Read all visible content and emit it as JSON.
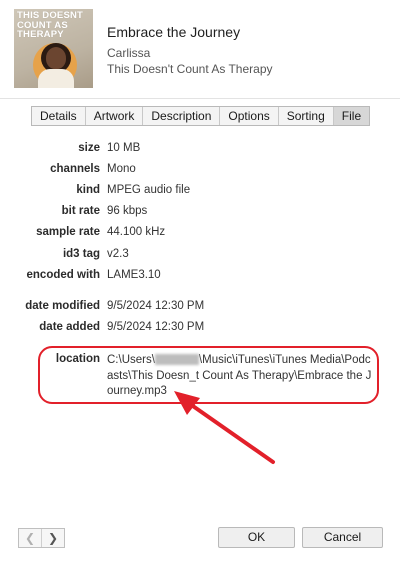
{
  "header": {
    "title": "Embrace the Journey",
    "artist": "Carlissa",
    "album": "This Doesn't Count As Therapy",
    "artwork_text": "THIS DOESNT COUNT AS THERAPY"
  },
  "tabs": [
    {
      "label": "Details",
      "active": false
    },
    {
      "label": "Artwork",
      "active": false
    },
    {
      "label": "Description",
      "active": false
    },
    {
      "label": "Options",
      "active": false
    },
    {
      "label": "Sorting",
      "active": false
    },
    {
      "label": "File",
      "active": true
    }
  ],
  "file_info": {
    "size": {
      "label": "size",
      "value": "10 MB"
    },
    "channels": {
      "label": "channels",
      "value": "Mono"
    },
    "kind": {
      "label": "kind",
      "value": "MPEG audio file"
    },
    "bit_rate": {
      "label": "bit rate",
      "value": "96 kbps"
    },
    "sample_rate": {
      "label": "sample rate",
      "value": "44.100 kHz"
    },
    "id3_tag": {
      "label": "id3 tag",
      "value": "v2.3"
    },
    "encoded_with": {
      "label": "encoded with",
      "value": "LAME3.10"
    },
    "date_modified": {
      "label": "date modified",
      "value": "9/5/2024 12:30 PM"
    },
    "date_added": {
      "label": "date added",
      "value": "9/5/2024 12:30 PM"
    },
    "location": {
      "label": "location",
      "prefix": "C:\\Users\\",
      "suffix": "\\Music\\iTunes\\iTunes Media\\Podcasts\\This Doesn_t Count As Therapy\\Embrace the Journey.mp3"
    }
  },
  "footer": {
    "prev_icon": "chevron-left",
    "next_icon": "chevron-right",
    "ok_label": "OK",
    "cancel_label": "Cancel"
  },
  "colors": {
    "annotation_red": "#e2202a",
    "active_tab": "#d7d7d7"
  }
}
